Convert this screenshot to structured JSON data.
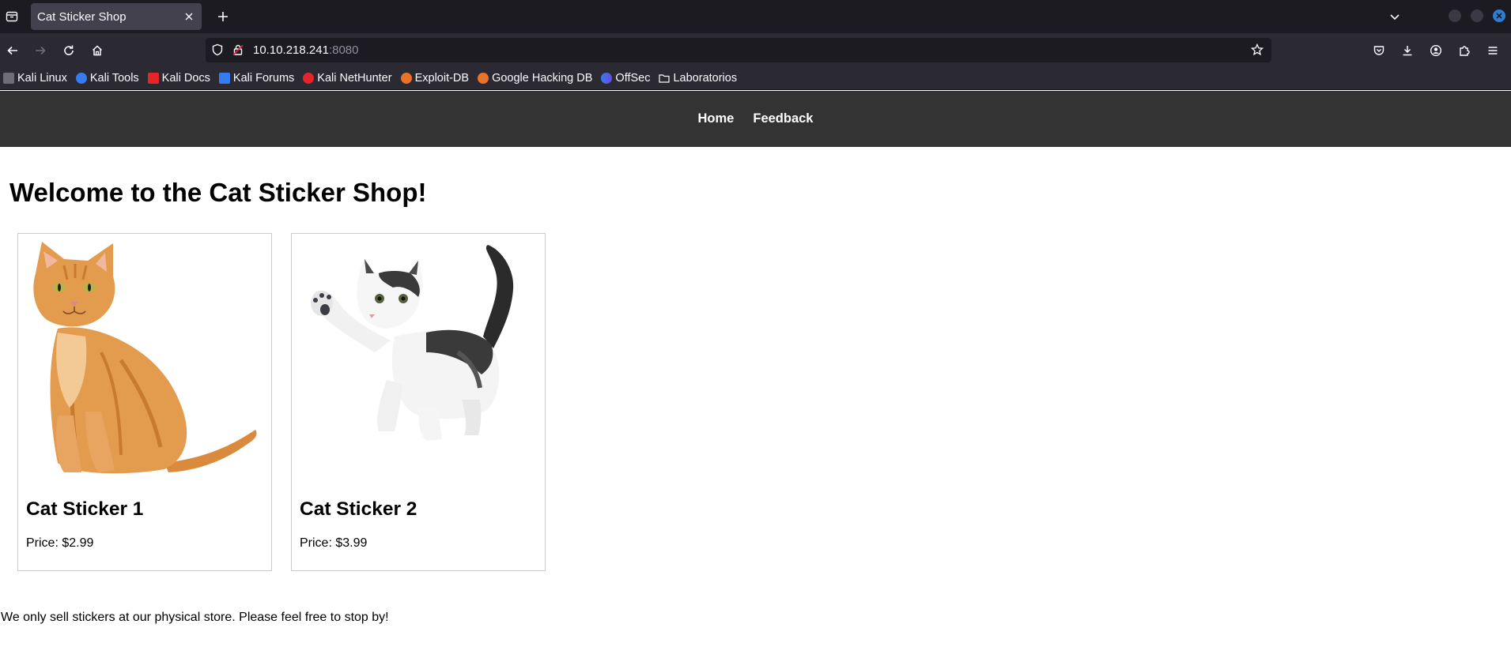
{
  "browser": {
    "tab_title": "Cat Sticker Shop",
    "url_host": "10.10.218.241",
    "url_port": ":8080",
    "bookmarks": [
      {
        "label": "Kali Linux",
        "color": "#2b2a33"
      },
      {
        "label": "Kali Tools",
        "color": "#367bf0"
      },
      {
        "label": "Kali Docs",
        "color": "#e3262a"
      },
      {
        "label": "Kali Forums",
        "color": "#367bf0"
      },
      {
        "label": "Kali NetHunter",
        "color": "#e3262a"
      },
      {
        "label": "Exploit-DB",
        "color": "#e8722b"
      },
      {
        "label": "Google Hacking DB",
        "color": "#e8722b"
      },
      {
        "label": "OffSec",
        "color": "#6a4bd8"
      },
      {
        "label": "Laboratorios",
        "color": "#fbfbfe"
      }
    ]
  },
  "site": {
    "nav": {
      "home": "Home",
      "feedback": "Feedback"
    },
    "title": "Welcome to the Cat Sticker Shop!",
    "products": [
      {
        "name": "Cat Sticker 1",
        "price": "Price: $2.99",
        "image": "orange-tabby-cat"
      },
      {
        "name": "Cat Sticker 2",
        "price": "Price: $3.99",
        "image": "white-tabby-kitten"
      }
    ],
    "footer": "We only sell stickers at our physical store. Please feel free to stop by!"
  },
  "colors": {
    "site_nav_bg": "#333333",
    "chrome_bg": "#1c1b22",
    "toolbar_bg": "#2b2a33"
  }
}
